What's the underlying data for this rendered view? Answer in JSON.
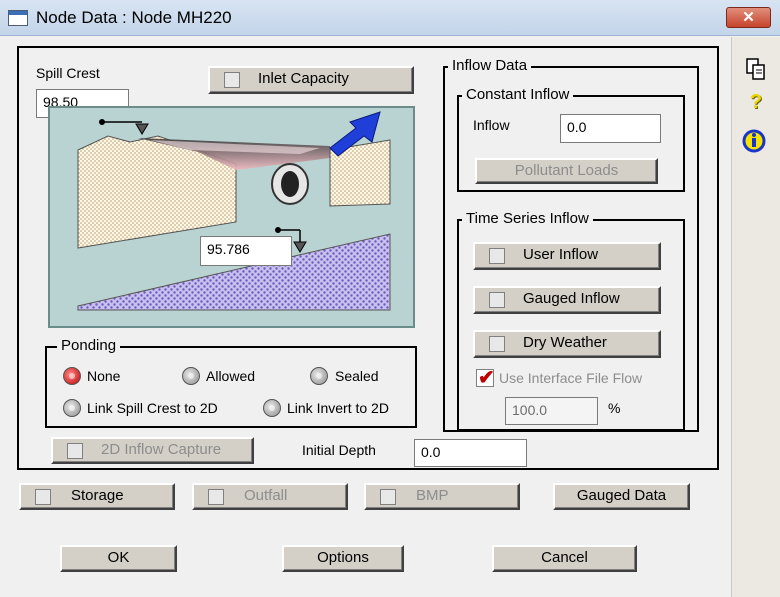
{
  "window": {
    "title": "Node Data : Node MH220",
    "close_label": "✕"
  },
  "spill_crest": {
    "label": "Spill Crest",
    "value": "98.50"
  },
  "invert_value": "95.786",
  "inlet_capacity_label": "Inlet Capacity",
  "ponding": {
    "title": "Ponding",
    "options": [
      {
        "label": "None",
        "selected": true
      },
      {
        "label": "Allowed",
        "selected": false
      },
      {
        "label": "Sealed",
        "selected": false
      },
      {
        "label": "Link Spill Crest to 2D",
        "selected": false
      },
      {
        "label": "Link Invert to 2D",
        "selected": false
      }
    ]
  },
  "inflow_data": {
    "title": "Inflow Data",
    "constant_inflow": {
      "title": "Constant Inflow",
      "inflow_label": "Inflow",
      "inflow_value": "0.0",
      "pollutant_loads_label": "Pollutant Loads"
    },
    "time_series": {
      "title": "Time Series Inflow",
      "user_inflow_label": "User Inflow",
      "gauged_inflow_label": "Gauged Inflow",
      "dry_weather_label": "Dry Weather",
      "interface_file_label": "Use Interface File Flow",
      "interface_checked": true,
      "percent_value": "100.0",
      "percent_unit": "%"
    }
  },
  "inflow_capture_label": "2D Inflow Capture",
  "initial_depth": {
    "label": "Initial Depth",
    "value": "0.0"
  },
  "bottom_buttons": {
    "storage": "Storage",
    "outfall": "Outfall",
    "bmp": "BMP",
    "gauged_data": "Gauged Data",
    "ok": "OK",
    "options": "Options",
    "cancel": "Cancel"
  },
  "side_icons": [
    "copy-icon",
    "help-icon",
    "info-icon"
  ],
  "colors": {
    "radio_selected": "#c00000",
    "arrow_blue": "#1f3fd8",
    "diagram_bg": "#b9d3d2"
  }
}
